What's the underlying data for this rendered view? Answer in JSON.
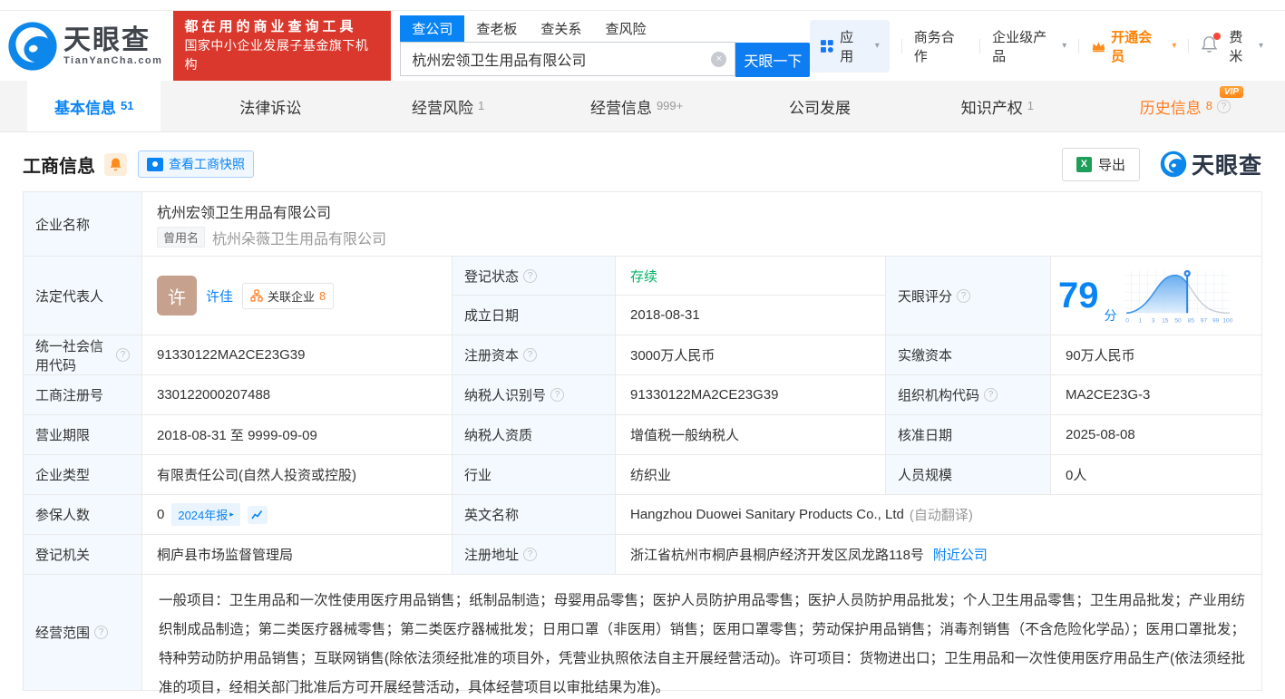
{
  "header": {
    "logo": {
      "name": "天眼查",
      "domain": "TianYanCha.com"
    },
    "banner": {
      "line1": "都在用的商业查询工具",
      "line2": "国家中小企业发展子基金旗下机构"
    },
    "search": {
      "tabs": [
        {
          "label": "查公司"
        },
        {
          "label": "查老板"
        },
        {
          "label": "查关系"
        },
        {
          "label": "查风险"
        }
      ],
      "value": "杭州宏领卫生用品有限公司",
      "button": "天眼一下"
    },
    "menu": {
      "apps": "应用",
      "biz": "商务合作",
      "enterprise": "企业级产品",
      "vip": "开通会员",
      "user": "费米"
    }
  },
  "nav": {
    "tabs": [
      {
        "label": "基本信息",
        "count": "51"
      },
      {
        "label": "法律诉讼",
        "count": ""
      },
      {
        "label": "经营风险",
        "count": "1"
      },
      {
        "label": "经营信息",
        "count": "999+"
      },
      {
        "label": "公司发展",
        "count": ""
      },
      {
        "label": "知识产权",
        "count": "1"
      },
      {
        "label": "历史信息",
        "count": "8",
        "badge": "VIP"
      }
    ]
  },
  "section": {
    "title": "工商信息",
    "snapshot": "查看工商快照",
    "export": "导出",
    "brand": "天眼查"
  },
  "fields": {
    "name_label": "企业名称",
    "name": "杭州宏领卫生用品有限公司",
    "former_label": "曾用名",
    "former_name": "杭州朵薇卫生用品有限公司",
    "legal_label": "法定代表人",
    "legal_avatar": "许",
    "legal_name": "许佳",
    "related": "关联企业",
    "related_count": "8",
    "status_label": "登记状态",
    "status": "存续",
    "founded_label": "成立日期",
    "founded": "2018-08-31",
    "score_label": "天眼评分",
    "score": "79",
    "score_unit": "分",
    "uscc_label": "统一社会信用代码",
    "uscc": "91330122MA2CE23G39",
    "regcap_label": "注册资本",
    "regcap": "3000万人民币",
    "paidcap_label": "实缴资本",
    "paidcap": "90万人民币",
    "regno_label": "工商注册号",
    "regno": "330122000207488",
    "taxid_label": "纳税人识别号",
    "taxid": "91330122MA2CE23G39",
    "orgcode_label": "组织机构代码",
    "orgcode": "MA2CE23G-3",
    "term_label": "营业期限",
    "term": "2018-08-31 至 9999-09-09",
    "taxq_label": "纳税人资质",
    "taxq": "增值税一般纳税人",
    "approved_label": "核准日期",
    "approved": "2025-08-08",
    "type_label": "企业类型",
    "type": "有限责任公司(自然人投资或控股)",
    "industry_label": "行业",
    "industry": "纺织业",
    "staff_label": "人员规模",
    "staff": "0人",
    "insured_label": "参保人数",
    "insured": "0",
    "annual_report": "2024年报",
    "english_label": "英文名称",
    "english": "Hangzhou Duowei Sanitary Products Co., Ltd",
    "english_note": "(自动翻译)",
    "authority_label": "登记机关",
    "authority": "桐庐县市场监督管理局",
    "address_label": "注册地址",
    "address": "浙江省杭州市桐庐县桐庐经济开发区凤龙路118号",
    "nearby": "附近公司",
    "scope_label": "经营范围",
    "scope": "一般项目：卫生用品和一次性使用医疗用品销售；纸制品制造；母婴用品零售；医护人员防护用品零售；医护人员防护用品批发；个人卫生用品零售；卫生用品批发；产业用纺织制成品制造；第二类医疗器械零售；第二类医疗器械批发；日用口罩（非医用）销售；医用口罩零售；劳动保护用品销售；消毒剂销售（不含危险化学品）；医用口罩批发；特种劳动防护用品销售；互联网销售(除依法须经批准的项目外，凭营业执照依法自主开展经营活动)。许可项目：货物进出口；卫生用品和一次性使用医疗用品生产(依法须经批准的项目，经相关部门批准后方可开展经营活动，具体经营项目以审批结果为准)。"
  },
  "score_chart": {
    "type": "line",
    "score": 79,
    "axis": [
      "0",
      "1",
      "3",
      "15",
      "50",
      "85",
      "97",
      "99",
      "100"
    ]
  },
  "colors": {
    "accent": "#0984f5",
    "orange": "#ff7d20",
    "green": "#00b365",
    "banner_red": "#da382c"
  }
}
